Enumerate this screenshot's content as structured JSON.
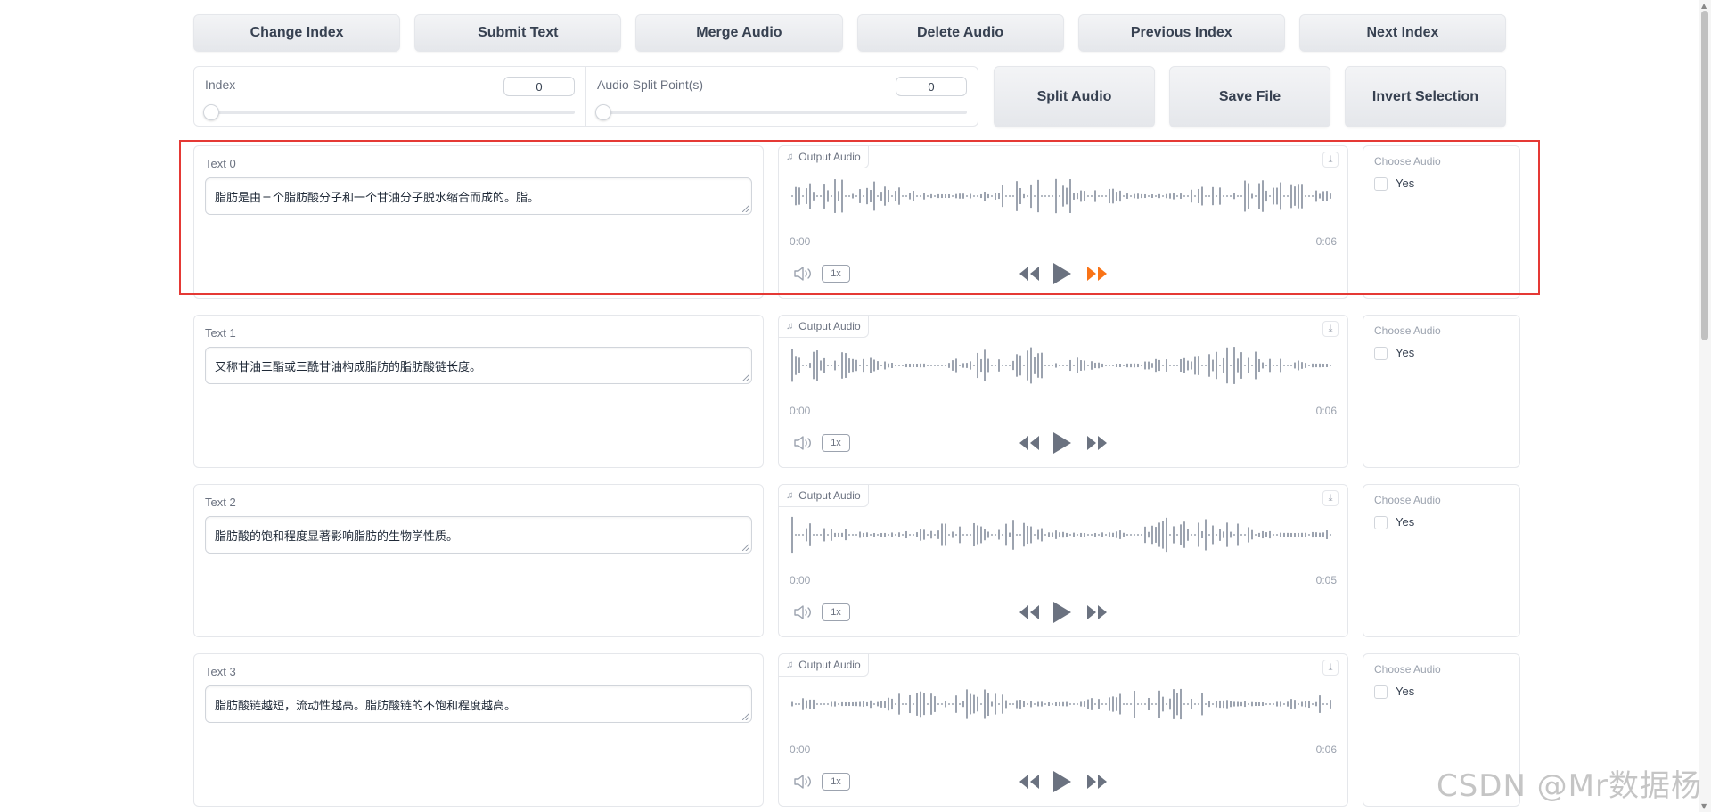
{
  "toolbar": {
    "buttons": [
      "Change Index",
      "Submit Text",
      "Merge Audio",
      "Delete Audio",
      "Previous Index",
      "Next Index"
    ]
  },
  "controls": {
    "index_label": "Index",
    "index_value": "0",
    "split_label": "Audio Split Point(s)",
    "split_value": "0",
    "split_button": "Split Audio",
    "save_button": "Save File",
    "invert_button": "Invert Selection"
  },
  "rows": [
    {
      "label": "Text 0",
      "text": "脂肪是由三个脂肪酸分子和一个甘油分子脱水缩合而成的。脂。",
      "audio_label": "Output Audio",
      "start": "0:00",
      "end": "0:06",
      "speed": "1x",
      "choose_label": "Choose Audio",
      "checkbox_label": "Yes",
      "checked": false
    },
    {
      "label": "Text 1",
      "text": "又称甘油三酯或三酰甘油构成脂肪的脂肪酸链长度。",
      "audio_label": "Output Audio",
      "start": "0:00",
      "end": "0:06",
      "speed": "1x",
      "choose_label": "Choose Audio",
      "checkbox_label": "Yes",
      "checked": false
    },
    {
      "label": "Text 2",
      "text": "脂肪酸的饱和程度显著影响脂肪的生物学性质。",
      "audio_label": "Output Audio",
      "start": "0:00",
      "end": "0:05",
      "speed": "1x",
      "choose_label": "Choose Audio",
      "checkbox_label": "Yes",
      "checked": false
    },
    {
      "label": "Text 3",
      "text": "脂肪酸链越短，流动性越高。脂肪酸链的不饱和程度越高。",
      "audio_label": "Output Audio",
      "start": "0:00",
      "end": "0:06",
      "speed": "1x",
      "choose_label": "Choose Audio",
      "checkbox_label": "Yes",
      "checked": false
    }
  ],
  "icons": {
    "audio": "music-note-icon",
    "download": "download-icon",
    "volume": "volume-icon",
    "rewind": "rewind-icon",
    "play": "play-icon",
    "forward": "fast-forward-icon"
  },
  "colors": {
    "highlight": "#e53935",
    "active_forward": "#f97316",
    "wave": "#9ca3af"
  },
  "watermark": "CSDN @Mr数据杨"
}
